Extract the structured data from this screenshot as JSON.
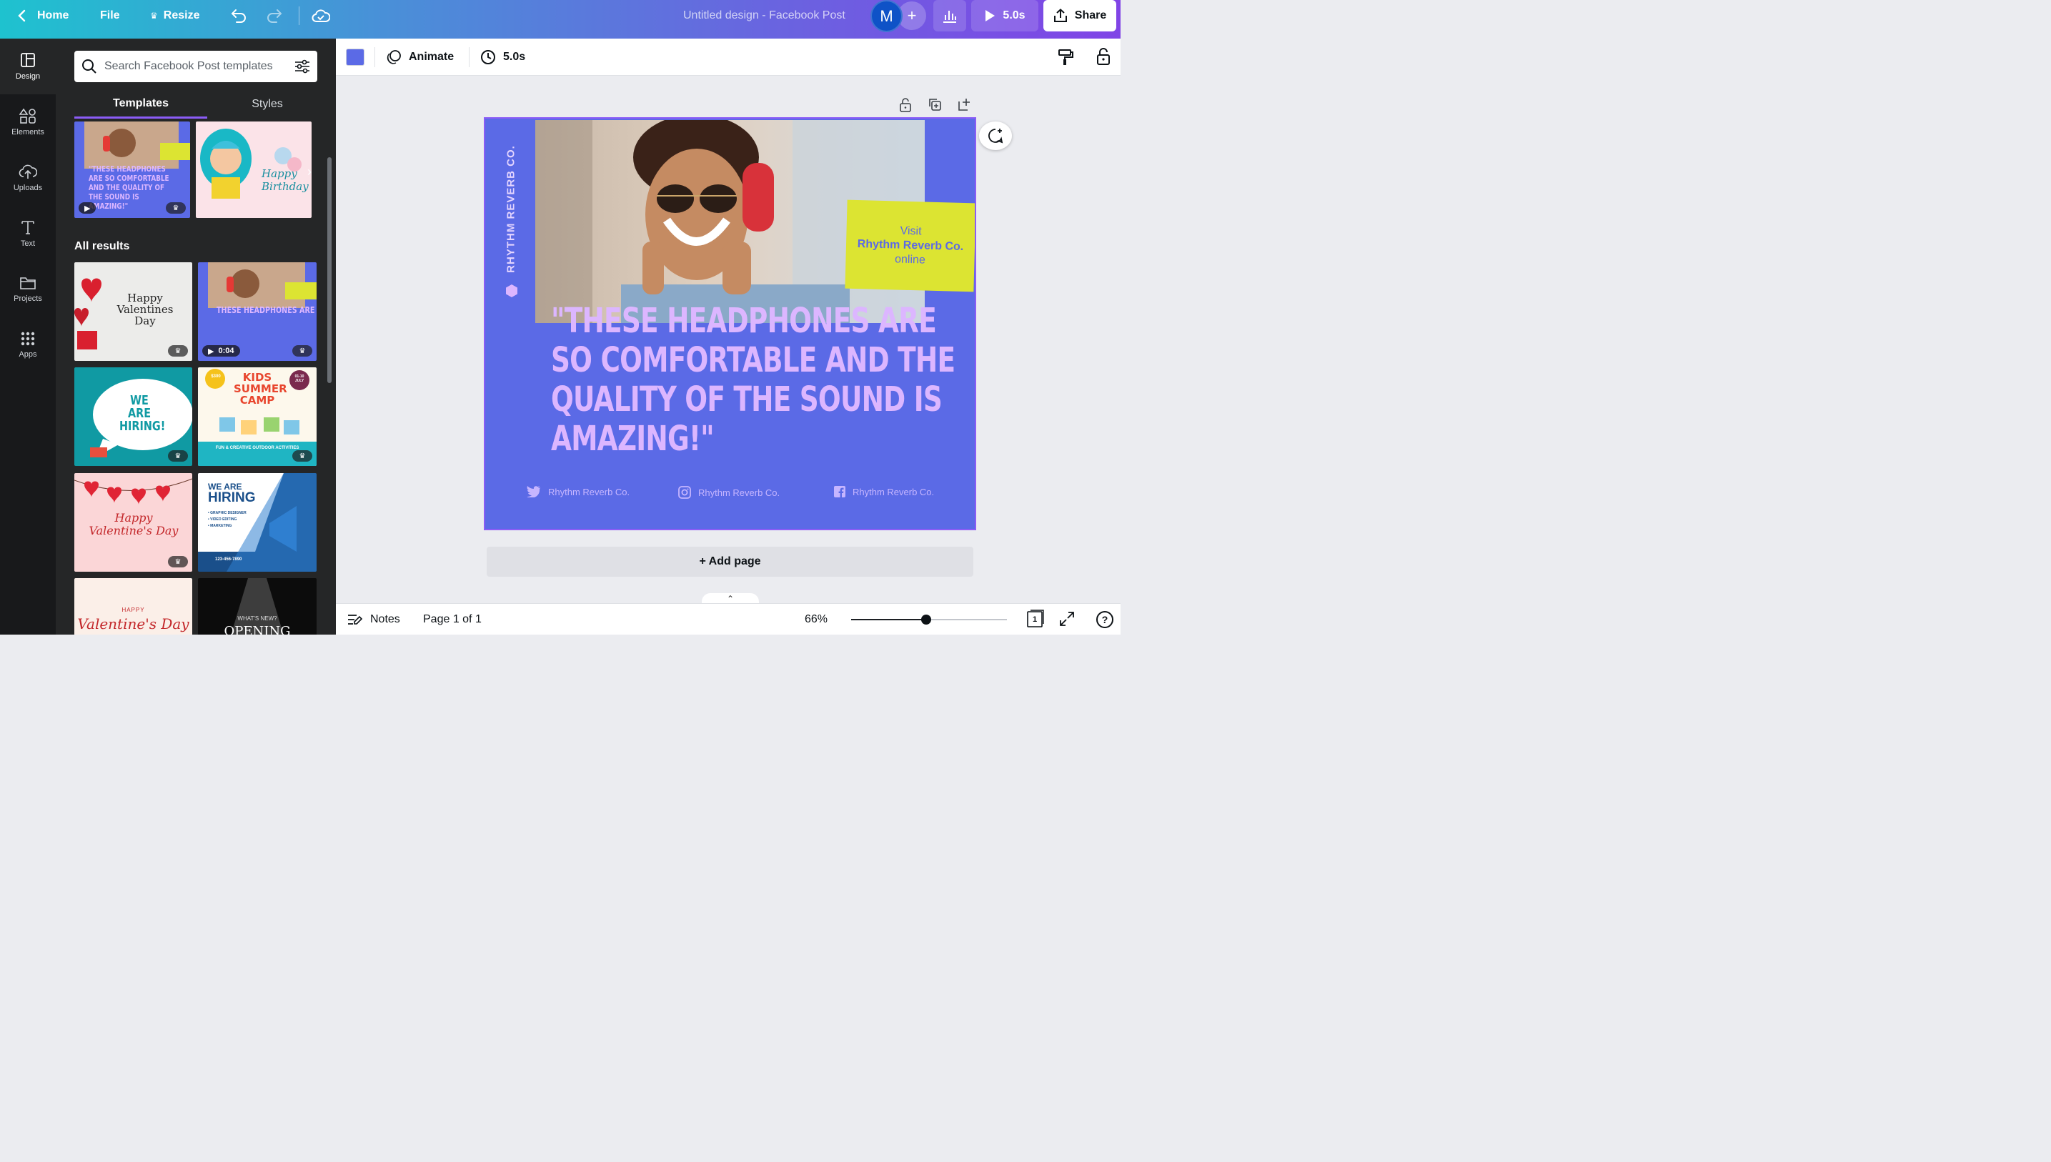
{
  "topbar": {
    "home": "Home",
    "file": "File",
    "resize": "Resize",
    "title": "Untitled design - Facebook Post",
    "avatar_initial": "M",
    "play_duration": "5.0s",
    "share": "Share"
  },
  "rail": {
    "items": [
      {
        "label": "Design",
        "icon": "layout-icon"
      },
      {
        "label": "Elements",
        "icon": "shapes-icon"
      },
      {
        "label": "Uploads",
        "icon": "cloud-upload-icon"
      },
      {
        "label": "Text",
        "icon": "text-icon"
      },
      {
        "label": "Projects",
        "icon": "folder-icon"
      },
      {
        "label": "Apps",
        "icon": "grid-icon"
      }
    ]
  },
  "panel": {
    "search_placeholder": "Search Facebook Post templates",
    "tabs": [
      "Templates",
      "Styles"
    ],
    "all_results": "All results",
    "featured": [
      {
        "name": "headphones",
        "text": "\"THESE HEADPHONES ARE SO COMFORTABLE AND THE QUALITY OF THE SOUND IS AMAZING!\""
      },
      {
        "name": "birthday",
        "text": "Happy Birthday"
      }
    ],
    "results": [
      {
        "name": "valentines-1",
        "text": "Happy Valentines Day"
      },
      {
        "name": "headphones-2",
        "text": "THESE HEADPHONES ARE",
        "duration": "0:04"
      },
      {
        "name": "hiring-1",
        "text": "WE ARE HIRING!"
      },
      {
        "name": "kids-camp",
        "text": "KIDS SUMMER CAMP",
        "price": "$300",
        "date": "01-10 JULY",
        "footer": "FUN & CREATIVE OUTDOOR ACTIVITIES"
      },
      {
        "name": "valentines-2",
        "text": "Happy Valentine's Day"
      },
      {
        "name": "hiring-2",
        "text_top": "WE ARE",
        "text_main": "HIRING",
        "phone": "123-456-7890",
        "items": [
          "• GRAPHIC DESIGNER",
          "• VIDEO EDITING",
          "• MARKETING"
        ]
      },
      {
        "name": "valentines-3",
        "text_top": "HAPPY",
        "text_main": "Valentine's Day"
      },
      {
        "name": "opening",
        "text_top": "WHAT'S NEW?",
        "text_main": "OPENING"
      }
    ]
  },
  "toolbar": {
    "animate": "Animate",
    "duration": "5.0s",
    "swatch_color": "#5b6ae6"
  },
  "design": {
    "brand_vertical": "RHYTHM REVERB CO.",
    "visit_line1": "Visit",
    "visit_line2": "Rhythm Reverb Co.",
    "visit_line3": "online",
    "quote_lines": [
      "\"THESE HEADPHONES ARE",
      "SO COMFORTABLE AND THE",
      "QUALITY OF THE SOUND IS",
      "AMAZING!\""
    ],
    "socials": [
      {
        "icon": "twitter-icon",
        "label": "Rhythm Reverb Co."
      },
      {
        "icon": "instagram-icon",
        "label": "Rhythm Reverb Co."
      },
      {
        "icon": "facebook-icon",
        "label": "Rhythm Reverb Co."
      }
    ],
    "background_color": "#5b6ae6",
    "accent_color": "#dce432",
    "quote_color": "#dcb6ff"
  },
  "add_page": "+ Add page",
  "bottombar": {
    "notes": "Notes",
    "page": "Page 1 of 1",
    "zoom": "66%",
    "zoom_fraction": 0.48,
    "page_count": "1"
  }
}
